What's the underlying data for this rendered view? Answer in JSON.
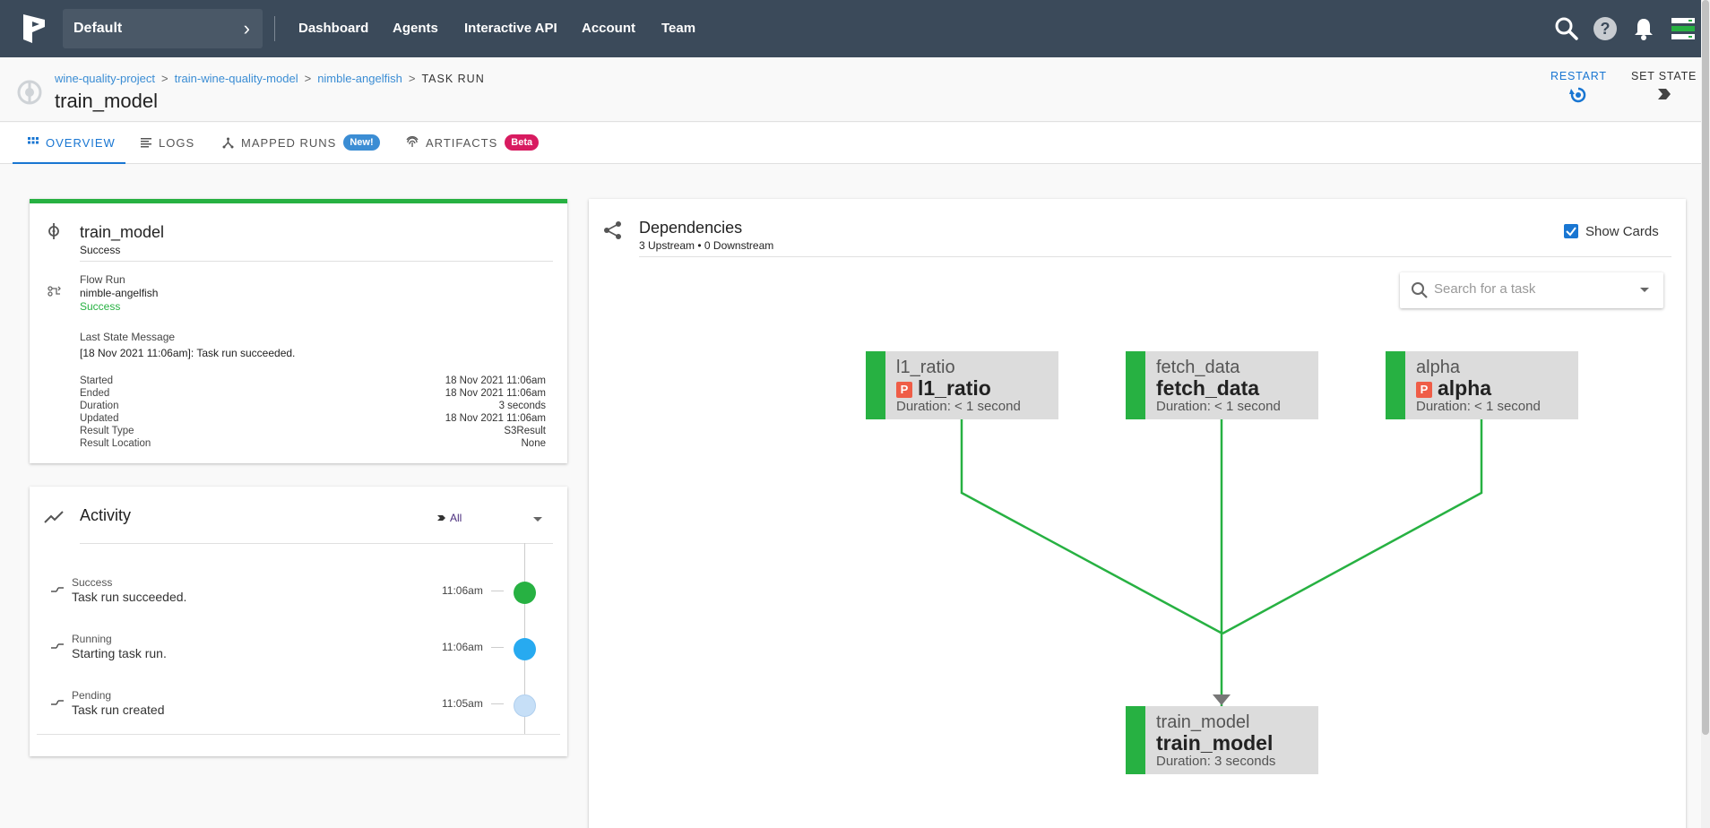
{
  "nav": {
    "team": "Default",
    "links": [
      "Dashboard",
      "Agents",
      "Interactive API",
      "Account",
      "Team"
    ]
  },
  "breadcrumb": {
    "project": "wine-quality-project",
    "flow": "train-wine-quality-model",
    "flow_run": "nimble-angelfish",
    "current": "TASK RUN"
  },
  "page_title": "train_model",
  "actions": {
    "restart": "RESTART",
    "set_state": "SET STATE"
  },
  "tabs": {
    "overview": "OVERVIEW",
    "logs": "LOGS",
    "mapped_runs": "MAPPED RUNS",
    "mapped_badge": "New!",
    "artifacts": "ARTIFACTS",
    "artifacts_badge": "Beta"
  },
  "details": {
    "title": "train_model",
    "state": "Success",
    "flow_run_label": "Flow Run",
    "flow_run_name": "nimble-angelfish",
    "flow_run_state": "Success",
    "last_msg_label": "Last State Message",
    "last_msg_time": "[18 Nov 2021 11:06am]",
    "last_msg_text": ": Task run succeeded.",
    "rows": [
      {
        "k": "Started",
        "v": "18 Nov 2021 11:06am"
      },
      {
        "k": "Ended",
        "v": "18 Nov 2021 11:06am"
      },
      {
        "k": "Duration",
        "v": "3 seconds"
      },
      {
        "k": "Updated",
        "v": "18 Nov 2021 11:06am"
      },
      {
        "k": "Result Type",
        "v": "S3Result"
      },
      {
        "k": "Result Location",
        "v": "None"
      }
    ]
  },
  "activity": {
    "title": "Activity",
    "filter": "All",
    "items": [
      {
        "state": "Success",
        "message": "Task run succeeded.",
        "time": "11:06am",
        "color": "#27b142"
      },
      {
        "state": "Running",
        "message": "Starting task run.",
        "time": "11:06am",
        "color": "#27aaf0"
      },
      {
        "state": "Pending",
        "message": "Task run created",
        "time": "11:05am",
        "color": "#c6dff7"
      }
    ]
  },
  "dependencies": {
    "title": "Dependencies",
    "subtitle": "3 Upstream • 0 Downstream",
    "show_cards": "Show Cards",
    "search_placeholder": "Search for a task",
    "upstream": [
      {
        "label": "l1_ratio",
        "name": "l1_ratio",
        "param": true,
        "duration": "Duration: < 1 second"
      },
      {
        "label": "fetch_data",
        "name": "fetch_data",
        "param": false,
        "duration": "Duration: < 1 second"
      },
      {
        "label": "alpha",
        "name": "alpha",
        "param": true,
        "duration": "Duration: < 1 second"
      }
    ],
    "target": {
      "label": "train_model",
      "name": "train_model",
      "duration": "Duration: 3 seconds"
    },
    "param_badge": "P",
    "edge_color": "#27b142"
  }
}
